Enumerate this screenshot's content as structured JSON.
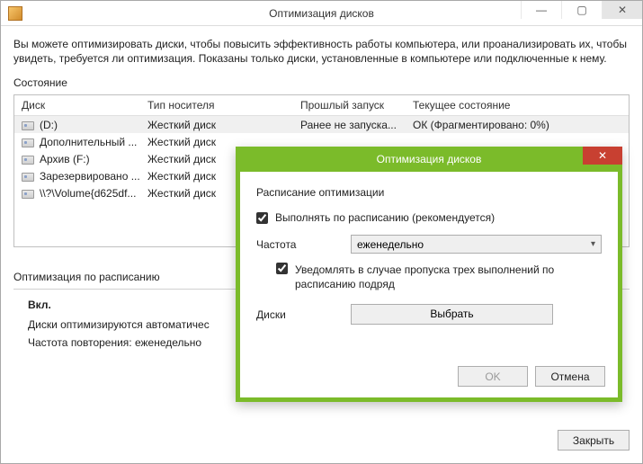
{
  "window": {
    "title": "Оптимизация дисков",
    "intro": "Вы можете оптимизировать диски, чтобы повысить эффективность работы  компьютера, или проанализировать их, чтобы увидеть, требуется ли оптимизация. Показаны только диски, установленные в компьютере или подключенные к нему.",
    "state_label": "Состояние"
  },
  "table": {
    "headers": {
      "col1": "Диск",
      "col2": "Тип носителя",
      "col3": "Прошлый запуск",
      "col4": "Текущее состояние"
    },
    "rows": [
      {
        "name": "(D:)",
        "type": "Жесткий диск",
        "last": "Ранее не запуска...",
        "state": "ОК (Фрагментировано: 0%)",
        "selected": true
      },
      {
        "name": "Дополнительный ...",
        "type": "Жесткий диск",
        "last": "",
        "state": "",
        "selected": false
      },
      {
        "name": "Архив (F:)",
        "type": "Жесткий диск",
        "last": "",
        "state": "",
        "selected": false
      },
      {
        "name": "Зарезервировано ...",
        "type": "Жесткий диск",
        "last": "",
        "state": "",
        "selected": false
      },
      {
        "name": "\\\\?\\Volume{d625df...",
        "type": "Жесткий диск",
        "last": "",
        "state": "",
        "selected": false
      }
    ]
  },
  "schedule": {
    "header": "Оптимизация по расписанию",
    "status": "Вкл.",
    "line1": "Диски оптимизируются автоматичес",
    "line2": "Частота повторения: еженедельно"
  },
  "footer": {
    "close": "Закрыть"
  },
  "modal": {
    "title": "Оптимизация дисков",
    "heading": "Расписание оптимизации",
    "run_on_schedule": "Выполнять по расписанию (рекомендуется)",
    "freq_label": "Частота",
    "freq_value": "еженедельно",
    "notify": "Уведомлять в случае пропуска трех выполнений по расписанию подряд",
    "disks_label": "Диски",
    "choose": "Выбрать",
    "ok": "OK",
    "cancel": "Отмена"
  }
}
